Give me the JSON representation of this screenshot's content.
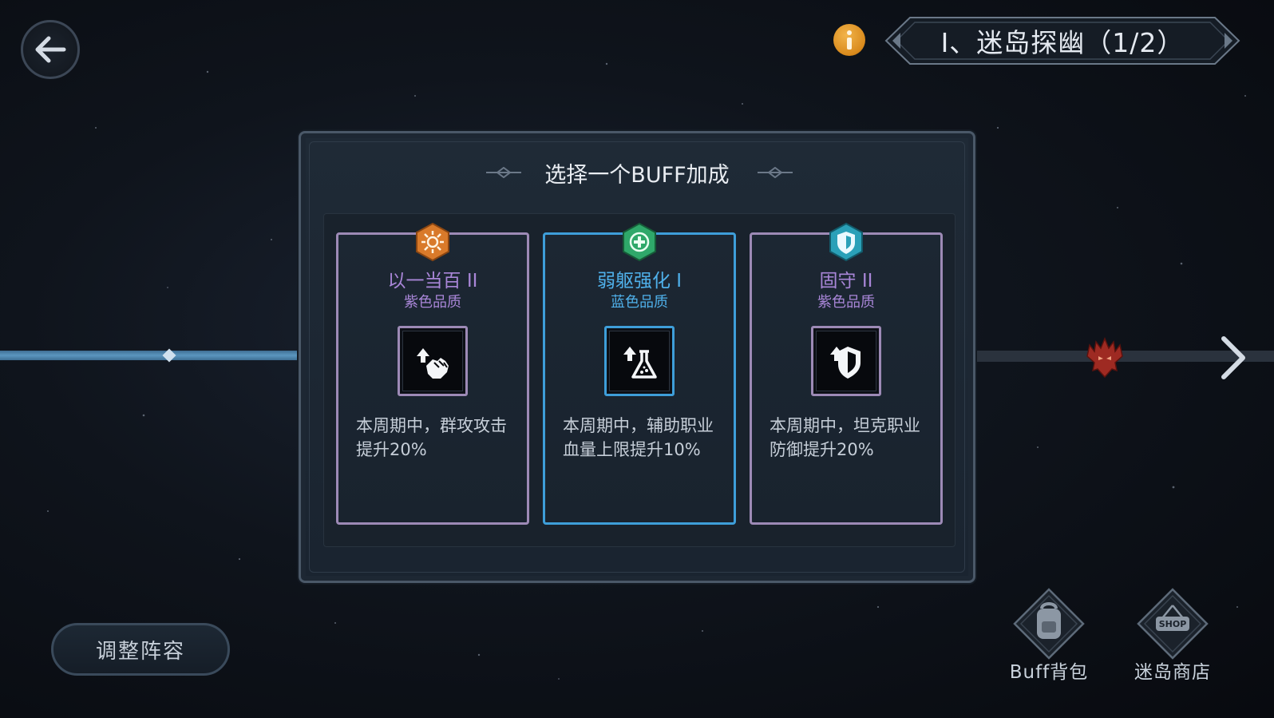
{
  "header": {
    "stage_title": "Ⅰ、迷岛探幽（1/2）"
  },
  "modal": {
    "title": "选择一个BUFF加成",
    "cards": [
      {
        "name": "以一当百 II",
        "quality": "紫色品质",
        "description": "本周期中，群攻攻击提升20%",
        "badge_icon": "sunburst-icon",
        "skill_icon": "fist-up-icon",
        "badge_color": "#d97a2a"
      },
      {
        "name": "弱躯强化 I",
        "quality": "蓝色品质",
        "description": "本周期中，辅助职业血量上限提升10%",
        "badge_icon": "heal-plus-icon",
        "skill_icon": "flask-up-icon",
        "badge_color": "#2fa86a"
      },
      {
        "name": "固守 II",
        "quality": "紫色品质",
        "description": "本周期中，坦克职业防御提升20%",
        "badge_icon": "shield-icon",
        "skill_icon": "shield-up-icon",
        "badge_color": "#2aa0b8"
      }
    ]
  },
  "footer": {
    "adjust_label": "调整阵容",
    "buff_bag_label": "Buff背包",
    "shop_label": "迷岛商店",
    "shop_sign": "SHOP"
  },
  "colors": {
    "purple_quality": "#a986d8",
    "blue_quality": "#4fb0ea",
    "info_orange": "#e39a2a"
  }
}
